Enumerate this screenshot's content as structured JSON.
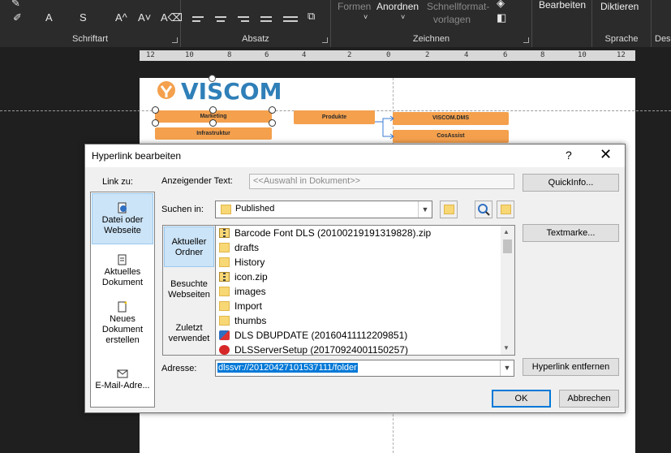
{
  "ribbon": {
    "font_group": "Schriftart",
    "paragraph_group": "Absatz",
    "drawing_group": "Zeichnen",
    "voice_group": "Sprache",
    "designer_group": "Des",
    "shapes": "Formen",
    "arrange": "Anordnen",
    "quick_styles_1": "Schnellformat-",
    "quick_styles_2": "vorlagen",
    "edit": "Bearbeiten",
    "dictate": "Diktieren"
  },
  "ruler": {
    "ticks": [
      "12",
      "10",
      "8",
      "6",
      "4",
      "2",
      "0",
      "2",
      "4",
      "6",
      "8",
      "10",
      "12"
    ]
  },
  "slide": {
    "logo_text": "VISCOM",
    "boxes": {
      "marketing": "Marketing",
      "infrastruktur": "Infrastruktur",
      "produkte": "Produkte",
      "viscom_dms": "VISCOM.DMS",
      "cosassist": "CosAssist"
    }
  },
  "dialog": {
    "title": "Hyperlink bearbeiten",
    "help": "?",
    "close": "✕",
    "link_to_label": "Link zu:",
    "display_text_label": "Anzeigender Text:",
    "display_text_value": "<<Auswahl in Dokument>>",
    "quickinfo_button": "QuickInfo...",
    "search_in_label": "Suchen in:",
    "search_in_value": "Published",
    "bookmark_button": "Textmarke...",
    "address_label": "Adresse:",
    "address_value": "dlssvr://20120427101537111/folder",
    "remove_button": "Hyperlink entfernen",
    "ok_button": "OK",
    "cancel_button": "Abbrechen",
    "link_types": [
      {
        "line1": "Datei oder",
        "line2": "Webseite"
      },
      {
        "line1": "Aktuelles",
        "line2": "Dokument"
      },
      {
        "line1": "Neues",
        "line2": "Dokument",
        "line3": "erstellen"
      },
      {
        "line1": "E-Mail-Adre..."
      }
    ],
    "nav": [
      {
        "line1": "Aktueller",
        "line2": "Ordner"
      },
      {
        "line1": "Besuchte",
        "line2": "Webseiten"
      },
      {
        "line1": "Zuletzt",
        "line2": "verwendet"
      }
    ],
    "files": [
      {
        "name": "Barcode Font DLS (20100219191319828).zip",
        "icon": "zip-icon"
      },
      {
        "name": "drafts",
        "icon": "folder-icon"
      },
      {
        "name": "History",
        "icon": "folder-icon"
      },
      {
        "name": "icon.zip",
        "icon": "zip-icon"
      },
      {
        "name": "images",
        "icon": "folder-icon"
      },
      {
        "name": "Import",
        "icon": "folder-icon"
      },
      {
        "name": "thumbs",
        "icon": "folder-icon"
      },
      {
        "name": "DLS DBUPDATE (20160411112209851)",
        "icon": "app-icon"
      },
      {
        "name": "DLSServerSetup (20170924001150257)",
        "icon": "setup-icon"
      }
    ]
  }
}
